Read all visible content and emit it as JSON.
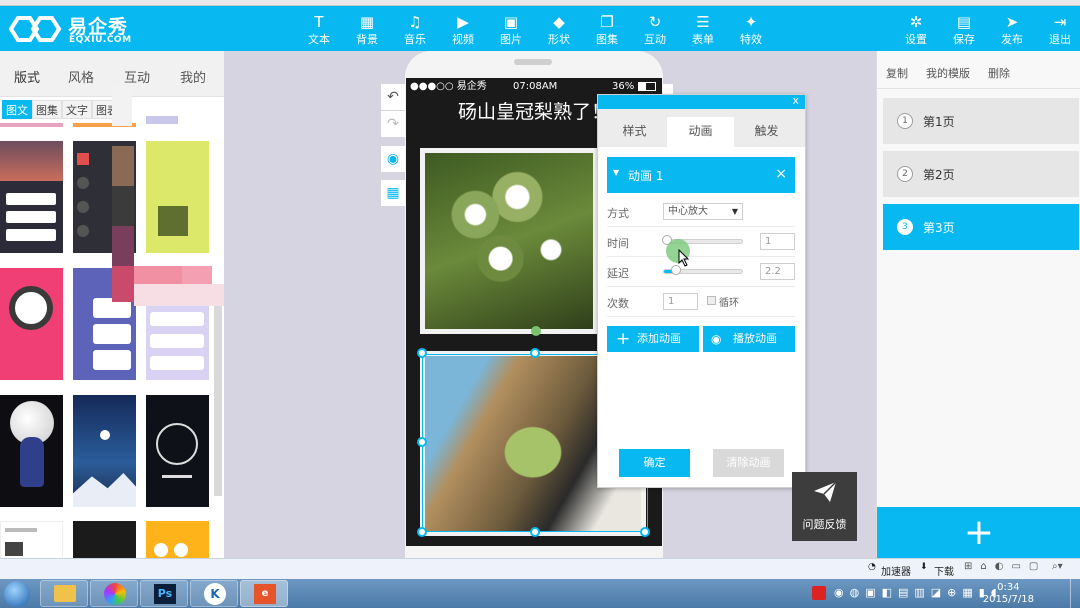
{
  "app": {
    "logo_cn": "易企秀",
    "logo_en": "EQXIU.COM",
    "brand_color": "#08b8f0"
  },
  "toolbar": {
    "center": [
      {
        "label": "文本",
        "icon": "text-icon"
      },
      {
        "label": "背景",
        "icon": "background-icon"
      },
      {
        "label": "音乐",
        "icon": "music-icon"
      },
      {
        "label": "视频",
        "icon": "video-icon"
      },
      {
        "label": "图片",
        "icon": "image-icon"
      },
      {
        "label": "形状",
        "icon": "shape-icon"
      },
      {
        "label": "图集",
        "icon": "gallery-icon"
      },
      {
        "label": "互动",
        "icon": "interaction-icon"
      },
      {
        "label": "表单",
        "icon": "form-icon"
      },
      {
        "label": "特效",
        "icon": "effects-icon"
      }
    ],
    "right": [
      {
        "label": "设置",
        "icon": "gear-icon"
      },
      {
        "label": "保存",
        "icon": "save-icon"
      },
      {
        "label": "发布",
        "icon": "publish-icon"
      },
      {
        "label": "退出",
        "icon": "exit-icon"
      }
    ]
  },
  "left_panel": {
    "tabs": [
      "版式",
      "风格",
      "互动",
      "我的"
    ],
    "active_tab": "版式",
    "subtabs": [
      "图文",
      "图集",
      "文字",
      "图表"
    ],
    "active_subtab": "图文"
  },
  "phone": {
    "status_left": "●●●○○ 易企秀",
    "status_time": "07:08AM",
    "status_battery": "36%",
    "headline": "砀山皇冠梨熟了！"
  },
  "dialog": {
    "close": "x",
    "tabs": [
      "样式",
      "动画",
      "触发"
    ],
    "active_tab": "动画",
    "animation_title": "动画 1",
    "animation_close": "×",
    "method_label": "方式",
    "method_value": "中心放大",
    "duration_label": "时间",
    "duration_value": "1",
    "duration_level": 0.03,
    "delay_label": "延迟",
    "delay_value": "2.2",
    "delay_level": 0.14,
    "count_label": "次数",
    "count_value": "1",
    "loop_label": "循环",
    "add_button": "添加动画",
    "play_button": "播放动画",
    "confirm_button": "确定",
    "clear_button": "清除动画"
  },
  "feedback": {
    "label": "问题反馈"
  },
  "right_panel": {
    "actions": [
      "复制",
      "我的模版",
      "删除"
    ],
    "pages": [
      {
        "num": "1",
        "label": "第1页"
      },
      {
        "num": "2",
        "label": "第2页"
      },
      {
        "num": "3",
        "label": "第3页"
      }
    ],
    "active_page": "第3页",
    "add_label": "+"
  },
  "statusline": {
    "accelerator": "加速器",
    "download": "下载"
  },
  "taskbar": {
    "time": "0:34",
    "date": "2015/7/18"
  }
}
